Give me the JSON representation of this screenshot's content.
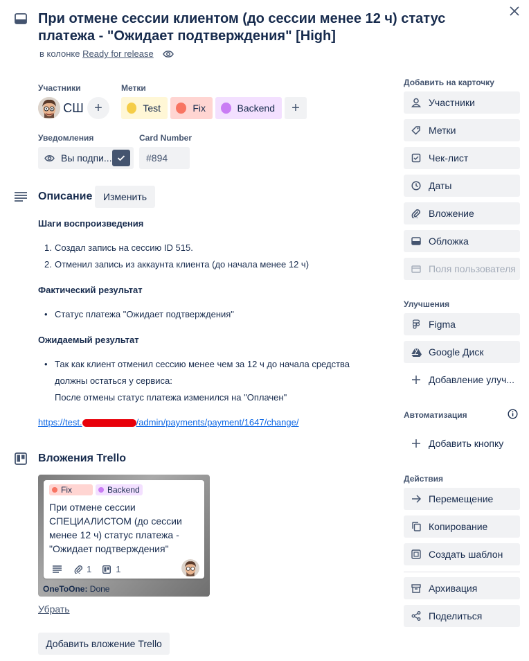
{
  "card": {
    "title": "При отмене сессии клиентом (до сессии менее 12 ч) статус платежа - \"Ожидает подтверждения\" [High]",
    "in_column_prefix": "в колонке",
    "column_name": "Ready for release"
  },
  "members": {
    "heading": "Участники",
    "initials": "СШ",
    "add": "+"
  },
  "labels": {
    "heading": "Метки",
    "items": [
      {
        "name": "Test",
        "color": "#f5cd47",
        "bg": "#fff7d6"
      },
      {
        "name": "Fix",
        "color": "#f87462",
        "bg": "#ffd5d2"
      },
      {
        "name": "Backend",
        "color": "#c97cf4",
        "bg": "#f3e0ff"
      }
    ],
    "add": "+"
  },
  "notifications": {
    "heading": "Уведомления",
    "button": "Вы подпи..."
  },
  "card_number": {
    "heading": "Card Number",
    "value": "#894"
  },
  "description": {
    "heading": "Описание",
    "edit_button": "Изменить",
    "steps_title": "Шаги воспроизведения",
    "steps": [
      "Создал запись на сессию ID 515.",
      "Отменил запись из аккаунта клиента (до начала менее 12 ч)"
    ],
    "actual_title": "Фактический результат",
    "actual_items": [
      "Статус платежа \"Ожидает подтверждения\""
    ],
    "expected_title": "Ожидаемый результат",
    "expected_line1": "Так как клиент отменил сессию менее чем за 12 ч до начала средства",
    "expected_line2": "должны остаться у сервиса:",
    "expected_line3": "После отмены статус платежа изменился на \"Оплачен\"",
    "link_prefix": "https://test.",
    "link_suffix": "/admin/payments/payment/1647/change/"
  },
  "attachments": {
    "heading": "Вложения Trello",
    "mini_card": {
      "labels": [
        "Fix",
        "Backend"
      ],
      "title_lines": [
        "При отмене сессии",
        "СПЕЦИАЛИСТОМ (до сессии",
        "менее 12 ч) статус платежа -",
        "\"Ожидает подтверждения\""
      ],
      "attachments_count": "1",
      "checklist_count": "1",
      "board_name": "OneToOne:",
      "list_name": "Done"
    },
    "remove_link": "Убрать",
    "add_button": "Добавить вложение Trello"
  },
  "sidebar": {
    "add_heading": "Добавить на карточку",
    "add_items": [
      "Участники",
      "Метки",
      "Чек-лист",
      "Даты",
      "Вложение",
      "Обложка",
      "Поля пользователя"
    ],
    "powerups_heading": "Улучшения",
    "powerups": [
      "Figma",
      "Google Диск",
      "Добавление улуч..."
    ],
    "automation_heading": "Автоматизация",
    "automation_add": "Добавить кнопку",
    "actions_heading": "Действия",
    "actions": [
      "Перемещение",
      "Копирование",
      "Создать шаблон",
      "Архивация",
      "Поделиться"
    ]
  }
}
